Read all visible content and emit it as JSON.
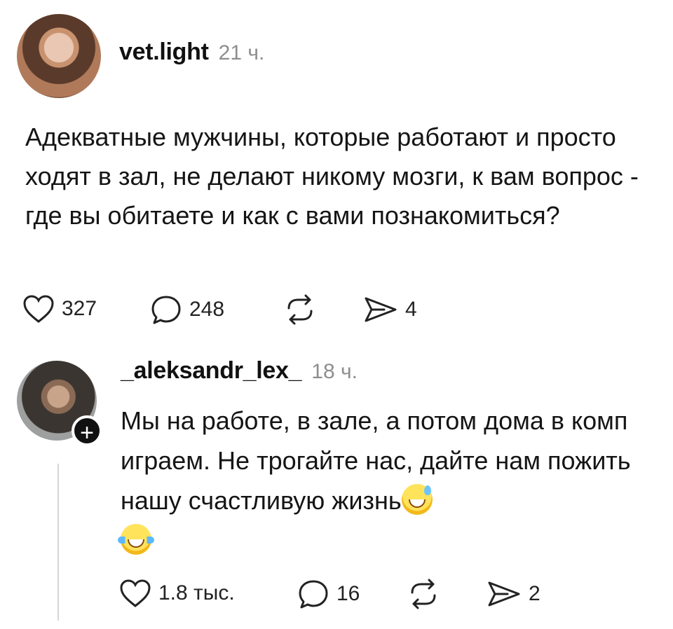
{
  "post": {
    "username": "vet.light",
    "time": "21 ч.",
    "text": "Адекватные мужчины, которые работают и просто ходят в зал, не делают никому мозги, к вам вопрос - где вы обитаете и как с вами познакомиться?",
    "likes": "327",
    "comments": "248",
    "shares": "4",
    "icons": [
      "heart-icon",
      "comment-icon",
      "repost-icon",
      "share-icon"
    ]
  },
  "reply": {
    "username": "_aleksandr_lex_",
    "time": "18 ч.",
    "text": "Мы на работе, в зале, а потом дома в комп играем. Не трогайте нас, дайте нам пожить нашу счастливую жизнь",
    "emojis": [
      "grinning-sweat-emoji",
      "tears-of-joy-emoji"
    ],
    "follow_badge": "+",
    "likes": "1.8 тыс.",
    "comments": "16",
    "shares": "2"
  }
}
